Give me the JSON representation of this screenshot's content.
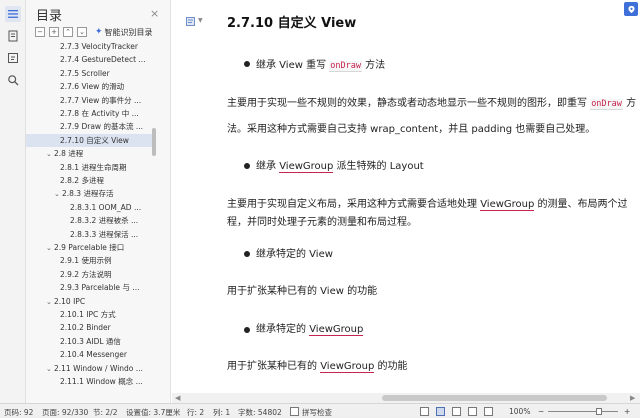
{
  "toc": {
    "title": "目录",
    "close": "×",
    "tool_icons": [
      "−",
      "+",
      "⌃",
      "⌄"
    ],
    "smart_label": "智能识别目录",
    "items": [
      {
        "label": "2.7.3 VelocityTracker",
        "indent": 2,
        "twisty": ""
      },
      {
        "label": "2.7.4 GestureDetect ...",
        "indent": 2,
        "twisty": ""
      },
      {
        "label": "2.7.5 Scroller",
        "indent": 2,
        "twisty": ""
      },
      {
        "label": "2.7.6 View 的滑动",
        "indent": 2,
        "twisty": ""
      },
      {
        "label": "2.7.7 View 的事件分 ...",
        "indent": 2,
        "twisty": ""
      },
      {
        "label": "2.7.8 在 Activity 中 ...",
        "indent": 2,
        "twisty": ""
      },
      {
        "label": "2.7.9 Draw 的基本流 ...",
        "indent": 2,
        "twisty": ""
      },
      {
        "label": "2.7.10 自定义 View",
        "indent": 2,
        "twisty": "",
        "selected": true
      },
      {
        "label": "2.8 进程",
        "indent": 0,
        "twisty": "⌄"
      },
      {
        "label": "2.8.1 进程生命周期",
        "indent": 2,
        "twisty": ""
      },
      {
        "label": "2.8.2 多进程",
        "indent": 2,
        "twisty": ""
      },
      {
        "label": "2.8.3 进程存活",
        "indent": 1,
        "twisty": "⌄"
      },
      {
        "label": "2.8.3.1 OOM_AD ...",
        "indent": 3,
        "twisty": ""
      },
      {
        "label": "2.8.3.2 进程被杀 ...",
        "indent": 3,
        "twisty": ""
      },
      {
        "label": "2.8.3.3 进程保活 ...",
        "indent": 3,
        "twisty": ""
      },
      {
        "label": "2.9 Parcelable 接口",
        "indent": 0,
        "twisty": "⌄"
      },
      {
        "label": "2.9.1 使用示例",
        "indent": 2,
        "twisty": ""
      },
      {
        "label": "2.9.2 方法说明",
        "indent": 2,
        "twisty": ""
      },
      {
        "label": "2.9.3 Parcelable 与 ...",
        "indent": 2,
        "twisty": ""
      },
      {
        "label": "2.10 IPC",
        "indent": 0,
        "twisty": "⌄"
      },
      {
        "label": "2.10.1 IPC 方式",
        "indent": 2,
        "twisty": ""
      },
      {
        "label": "2.10.2 Binder",
        "indent": 2,
        "twisty": ""
      },
      {
        "label": "2.10.3 AIDL 通信",
        "indent": 2,
        "twisty": ""
      },
      {
        "label": "2.10.4 Messenger",
        "indent": 2,
        "twisty": ""
      },
      {
        "label": "2.11 Window / Windo ...",
        "indent": 0,
        "twisty": "⌄"
      },
      {
        "label": "2.11.1 Window 概念 ...",
        "indent": 2,
        "twisty": ""
      }
    ]
  },
  "doc": {
    "heading": "2.7.10  自定义  View",
    "b1_a": "继承  View  重写 ",
    "b1_code": "onDraw",
    "b1_b": " 方法",
    "p1_l1_a": "主要用于实现一些不规则的效果，静态或者动态地显示一些不规则的图形，即重写 ",
    "p1_l1_code": "onDraw",
    "p1_l1_b": " 方",
    "p1_l2": "法。采用这种方式需要自己支持  wrap_content，并且  padding  也需要自己处理。",
    "b2_a": "继承  ",
    "b2_ul": "ViewGroup",
    "b2_b": "  派生特殊的  Layout",
    "p2_l1_a": "主要用于实现自定义布局，采用这种方式需要合适地处理  ",
    "p2_l1_ul": "ViewGroup",
    "p2_l1_b": "  的测量、布局两个过",
    "p2_l2": "程，并同时处理子元素的测量和布局过程。",
    "b3": "继承特定的  View",
    "p3": "用于扩张某种已有的  View  的功能",
    "b4_a": "继承特定的  ",
    "b4_ul": "ViewGroup",
    "p4_a": "用于扩张某种已有的  ",
    "p4_ul": "ViewGroup",
    "p4_b": "  的功能"
  },
  "status": {
    "page_num": "页码: 92",
    "pages": "页面: 92/330",
    "section": "节: 2/2",
    "setting": "设置值: 3.7厘米",
    "row": "行: 2",
    "col": "列: 1",
    "words": "字数: 54802",
    "spell": "拼写检查",
    "zoom": "100%",
    "zoom_minus": "−",
    "zoom_plus": "+"
  },
  "colors": {
    "accent": "#3f6fd8",
    "code": "#c7254e",
    "selected_bg": "#dbe3f1"
  }
}
